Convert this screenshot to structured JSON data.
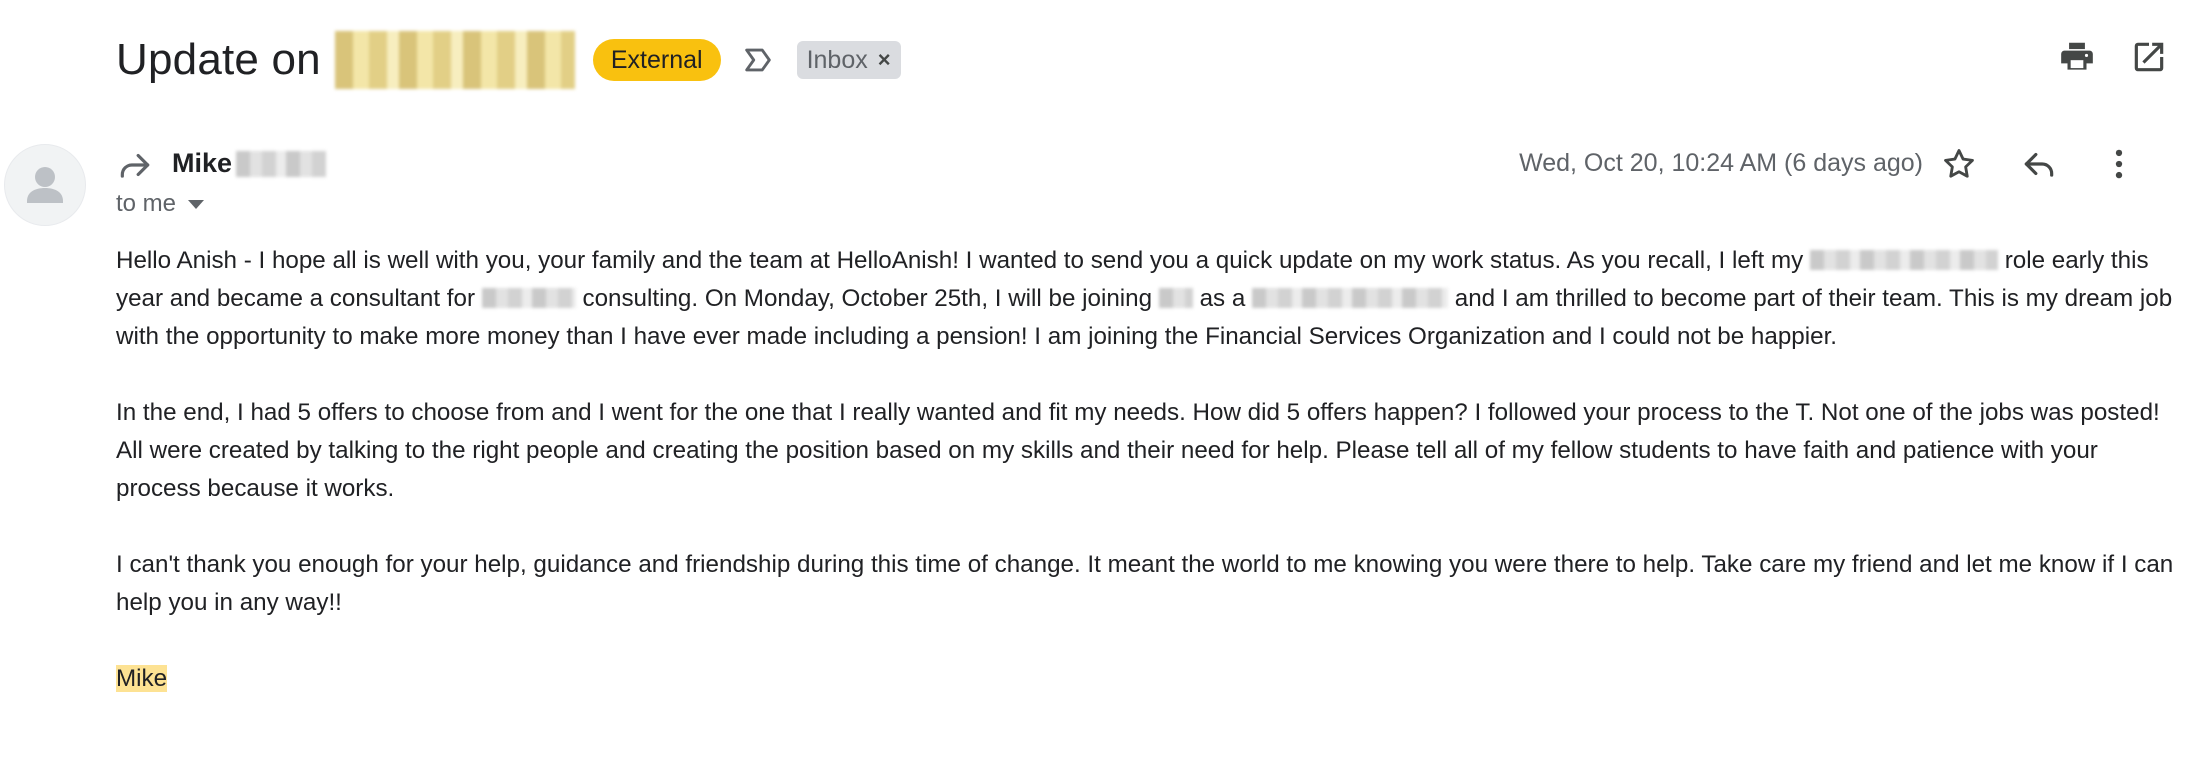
{
  "subject": {
    "title": "Update on",
    "labels": {
      "external": "External",
      "inbox": "Inbox",
      "remove": "×"
    }
  },
  "message": {
    "sender": "Mike",
    "to_line": "to me",
    "date": "Wed, Oct 20, 10:24 AM (6 days ago)",
    "paragraphs": [
      {
        "a": "Hello Anish - I hope all is well with you, your family and the team at HelloAnish!  I wanted to send you a quick update on my work status.  As you recall, I left my",
        "b": "role early this year and became a consultant for",
        "c": "consulting.  On Monday, October 25th, I will be joining",
        "d": "as a",
        "e": "and I am thrilled to become part of their team.  This is my dream job with the opportunity to make more money than I have ever made including a pension!  I am joining the Financial Services Organization and I could not be happier."
      },
      "In the end, I had 5 offers to choose from and I went for the one that I really wanted and fit my needs.  How did 5 offers happen?  I followed your process to the T.  Not one of the jobs was posted! All were created by talking to the right people and creating the position based on my skills and their need for help.  Please tell all of my fellow students to have faith and patience with your process because it works.",
      "I can't thank you enough for your help, guidance and friendship during this time of change.  It meant the world to me knowing you were there to help.  Take care my friend and let me know if I can help you in any way!!"
    ],
    "signature": "Mike"
  },
  "icons": {
    "importance": "importance-marker-icon",
    "print": "print-icon",
    "open_new_window": "open-in-new-window-icon",
    "forwarded": "forwarded-icon",
    "star": "star-icon",
    "reply": "reply-icon",
    "more": "more-vertical-icon",
    "avatar": "avatar-person-icon"
  },
  "colors": {
    "external_label": "#f9c10f",
    "inbox_label": "#dadce0",
    "signature_highlight": "#fde293"
  }
}
